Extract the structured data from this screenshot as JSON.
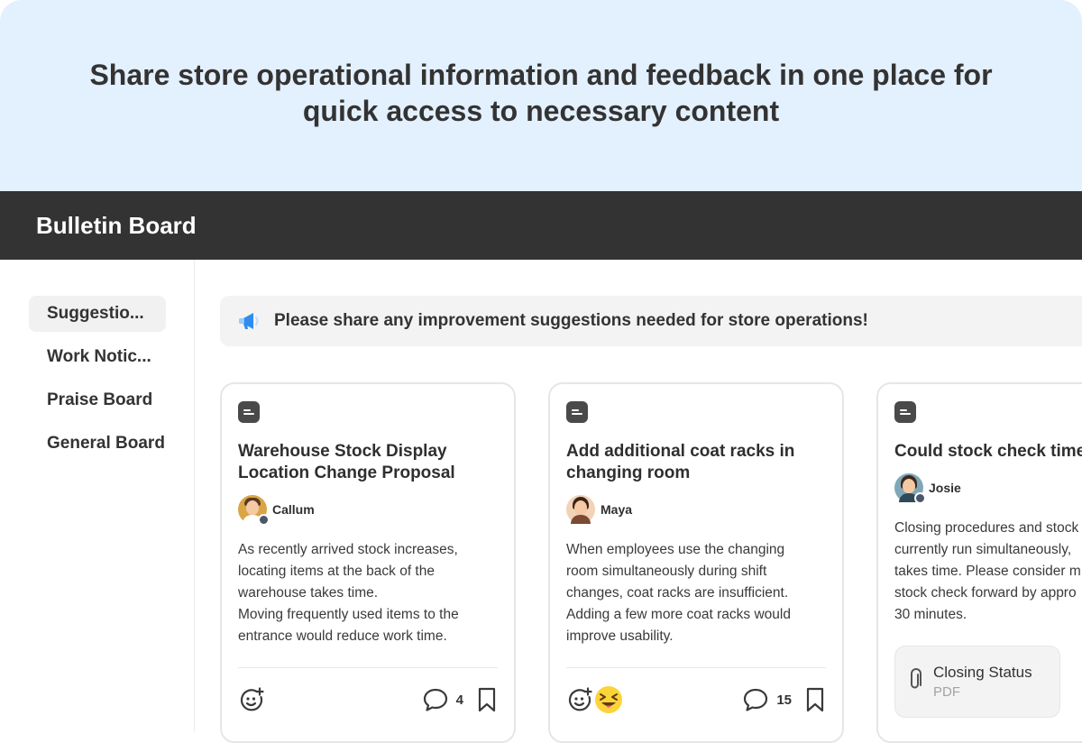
{
  "hero": {
    "headline": "Share store operational information and feedback in one place for quick access to necessary content"
  },
  "appbar": {
    "title": "Bulletin Board"
  },
  "sidebar": {
    "items": [
      {
        "label": "Suggestio...",
        "active": true
      },
      {
        "label": "Work Notic...",
        "active": false
      },
      {
        "label": "Praise Board",
        "active": false
      },
      {
        "label": "General Board",
        "active": false
      }
    ]
  },
  "banner": {
    "icon": "megaphone-icon",
    "text": "Please share any improvement suggestions needed for store operations!"
  },
  "cards": [
    {
      "title": "Warehouse Stock Display\nLocation Change Proposal",
      "author": "Callum",
      "body": "As recently arrived stock increases,\nlocating items at the back of the\nwarehouse takes time.\nMoving frequently used items to the\nentrance would reduce work time.",
      "comment_count": "4"
    },
    {
      "title": "Add additional coat racks in\nchanging room",
      "author": "Maya",
      "body": "When employees use the changing\nroom simultaneously during shift\nchanges, coat racks are insufficient.\nAdding a few more coat racks would\nimprove usability.",
      "comment_count": "15",
      "reaction": "squinting-tongue-emoji"
    },
    {
      "title": "Could stock check time",
      "author": "Josie",
      "body": "Closing procedures and stock\ncurrently run simultaneously,\ntakes time. Please consider m\nstock check forward by appro\n30 minutes.",
      "attachment": {
        "name": "Closing Status",
        "type": "PDF"
      }
    }
  ],
  "colors": {
    "hero_bg": "#e3f0fd",
    "appbar_bg": "#333333",
    "banner_bg": "#f3f3f3",
    "badge": "#4d5669",
    "megaphone": "#2f8cf0"
  }
}
